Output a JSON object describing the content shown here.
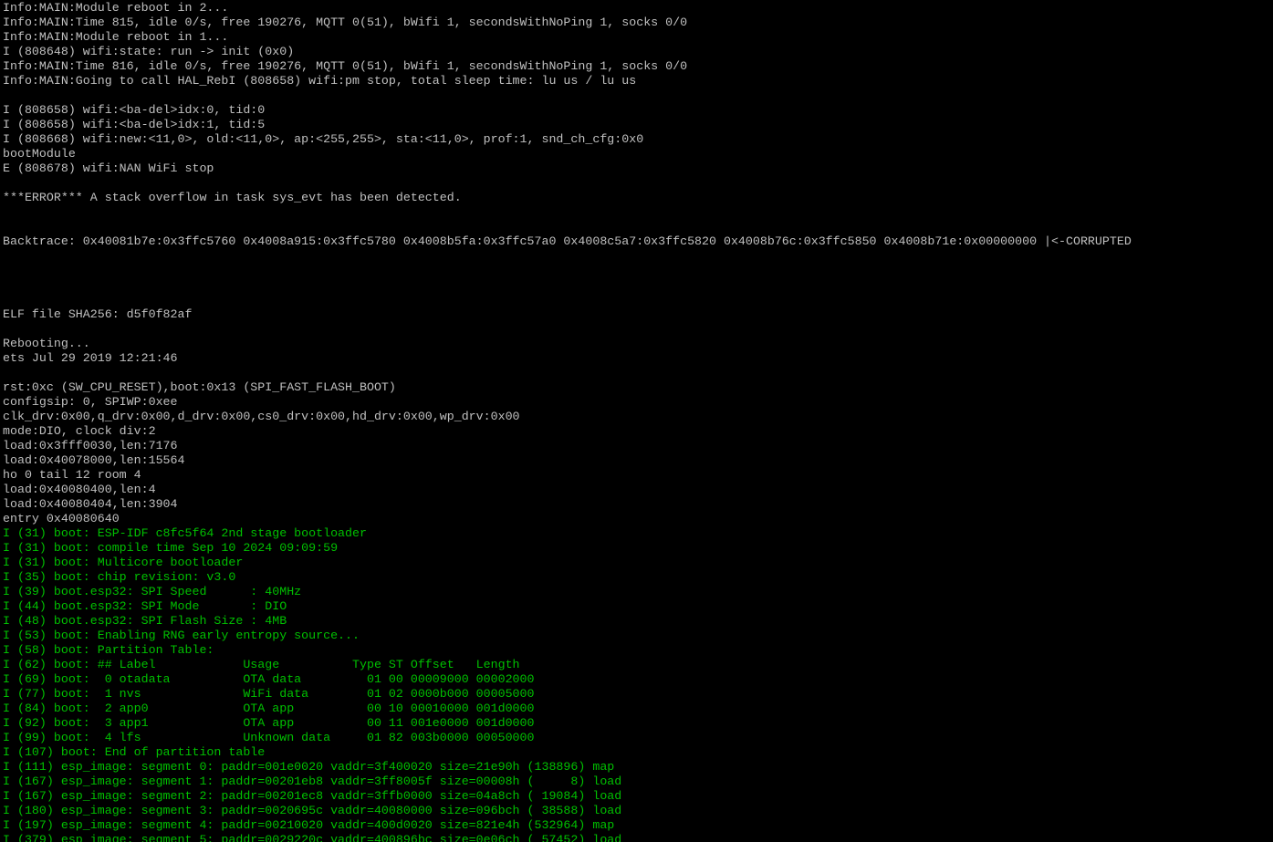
{
  "terminal": {
    "colors": {
      "background": "#000000",
      "default": "#c0c0c0",
      "info": "#00c000"
    },
    "lines": [
      {
        "text": "Info:MAIN:Module reboot in 2...",
        "color": "white"
      },
      {
        "text": "Info:MAIN:Time 815, idle 0/s, free 190276, MQTT 0(51), bWifi 1, secondsWithNoPing 1, socks 0/0",
        "color": "white"
      },
      {
        "text": "Info:MAIN:Module reboot in 1...",
        "color": "white"
      },
      {
        "text": "I (808648) wifi:state: run -> init (0x0)",
        "color": "white"
      },
      {
        "text": "Info:MAIN:Time 816, idle 0/s, free 190276, MQTT 0(51), bWifi 1, secondsWithNoPing 1, socks 0/0",
        "color": "white"
      },
      {
        "text": "Info:MAIN:Going to call HAL_RebI (808658) wifi:pm stop, total sleep time: lu us / lu us",
        "color": "white"
      },
      {
        "text": "",
        "color": "white"
      },
      {
        "text": "I (808658) wifi:<ba-del>idx:0, tid:0",
        "color": "white"
      },
      {
        "text": "I (808658) wifi:<ba-del>idx:1, tid:5",
        "color": "white"
      },
      {
        "text": "I (808668) wifi:new:<11,0>, old:<11,0>, ap:<255,255>, sta:<11,0>, prof:1, snd_ch_cfg:0x0",
        "color": "white"
      },
      {
        "text": "bootModule",
        "color": "white"
      },
      {
        "text": "E (808678) wifi:NAN WiFi stop",
        "color": "white"
      },
      {
        "text": "",
        "color": "white"
      },
      {
        "text": "***ERROR*** A stack overflow in task sys_evt has been detected.",
        "color": "white"
      },
      {
        "text": "",
        "color": "white"
      },
      {
        "text": "",
        "color": "white"
      },
      {
        "text": "Backtrace: 0x40081b7e:0x3ffc5760 0x4008a915:0x3ffc5780 0x4008b5fa:0x3ffc57a0 0x4008c5a7:0x3ffc5820 0x4008b76c:0x3ffc5850 0x4008b71e:0x00000000 |<-CORRUPTED",
        "color": "white"
      },
      {
        "text": "",
        "color": "white"
      },
      {
        "text": "",
        "color": "white"
      },
      {
        "text": "",
        "color": "white"
      },
      {
        "text": "",
        "color": "white"
      },
      {
        "text": "ELF file SHA256: d5f0f82af",
        "color": "white"
      },
      {
        "text": "",
        "color": "white"
      },
      {
        "text": "Rebooting...",
        "color": "white"
      },
      {
        "text": "ets Jul 29 2019 12:21:46",
        "color": "white"
      },
      {
        "text": "",
        "color": "white"
      },
      {
        "text": "rst:0xc (SW_CPU_RESET),boot:0x13 (SPI_FAST_FLASH_BOOT)",
        "color": "white"
      },
      {
        "text": "configsip: 0, SPIWP:0xee",
        "color": "white"
      },
      {
        "text": "clk_drv:0x00,q_drv:0x00,d_drv:0x00,cs0_drv:0x00,hd_drv:0x00,wp_drv:0x00",
        "color": "white"
      },
      {
        "text": "mode:DIO, clock div:2",
        "color": "white"
      },
      {
        "text": "load:0x3fff0030,len:7176",
        "color": "white"
      },
      {
        "text": "load:0x40078000,len:15564",
        "color": "white"
      },
      {
        "text": "ho 0 tail 12 room 4",
        "color": "white"
      },
      {
        "text": "load:0x40080400,len:4",
        "color": "white"
      },
      {
        "text": "load:0x40080404,len:3904",
        "color": "white"
      },
      {
        "text": "entry 0x40080640",
        "color": "white"
      },
      {
        "text": "I (31) boot: ESP-IDF c8fc5f64 2nd stage bootloader",
        "color": "green"
      },
      {
        "text": "I (31) boot: compile time Sep 10 2024 09:09:59",
        "color": "green"
      },
      {
        "text": "I (31) boot: Multicore bootloader",
        "color": "green"
      },
      {
        "text": "I (35) boot: chip revision: v3.0",
        "color": "green"
      },
      {
        "text": "I (39) boot.esp32: SPI Speed      : 40MHz",
        "color": "green"
      },
      {
        "text": "I (44) boot.esp32: SPI Mode       : DIO",
        "color": "green"
      },
      {
        "text": "I (48) boot.esp32: SPI Flash Size : 4MB",
        "color": "green"
      },
      {
        "text": "I (53) boot: Enabling RNG early entropy source...",
        "color": "green"
      },
      {
        "text": "I (58) boot: Partition Table:",
        "color": "green"
      },
      {
        "text": "I (62) boot: ## Label            Usage          Type ST Offset   Length",
        "color": "green"
      },
      {
        "text": "I (69) boot:  0 otadata          OTA data         01 00 00009000 00002000",
        "color": "green"
      },
      {
        "text": "I (77) boot:  1 nvs              WiFi data        01 02 0000b000 00005000",
        "color": "green"
      },
      {
        "text": "I (84) boot:  2 app0             OTA app          00 10 00010000 001d0000",
        "color": "green"
      },
      {
        "text": "I (92) boot:  3 app1             OTA app          00 11 001e0000 001d0000",
        "color": "green"
      },
      {
        "text": "I (99) boot:  4 lfs              Unknown data     01 82 003b0000 00050000",
        "color": "green"
      },
      {
        "text": "I (107) boot: End of partition table",
        "color": "green"
      },
      {
        "text": "I (111) esp_image: segment 0: paddr=001e0020 vaddr=3f400020 size=21e90h (138896) map",
        "color": "green"
      },
      {
        "text": "I (167) esp_image: segment 1: paddr=00201eb8 vaddr=3ff8005f size=00008h (     8) load",
        "color": "green"
      },
      {
        "text": "I (167) esp_image: segment 2: paddr=00201ec8 vaddr=3ffb0000 size=04a8ch ( 19084) load",
        "color": "green"
      },
      {
        "text": "I (180) esp_image: segment 3: paddr=0020695c vaddr=40080000 size=096bch ( 38588) load",
        "color": "green"
      },
      {
        "text": "I (197) esp_image: segment 4: paddr=00210020 vaddr=400d0020 size=821e4h (532964) map",
        "color": "green"
      },
      {
        "text": "I (379) esp_image: segment 5: paddr=0029220c vaddr=400896bc size=0e06ch ( 57452) load",
        "color": "green"
      }
    ]
  }
}
